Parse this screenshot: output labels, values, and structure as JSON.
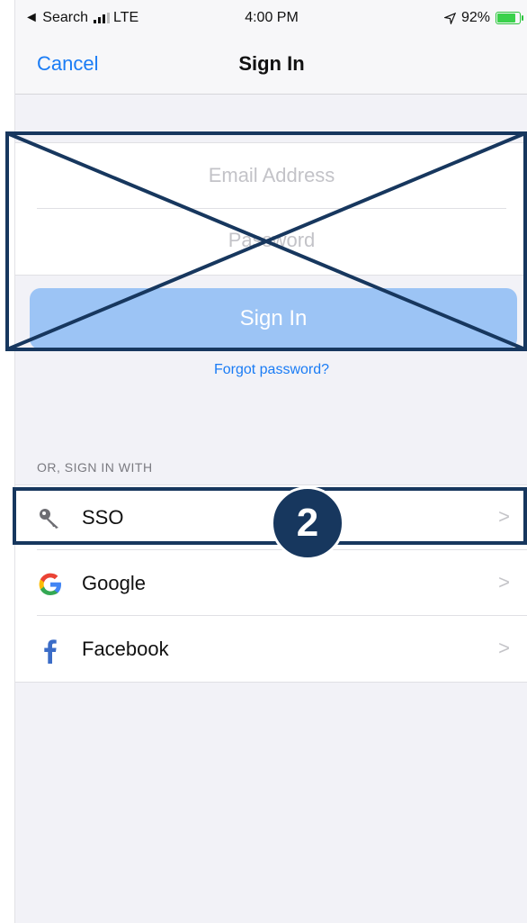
{
  "status_bar": {
    "back_app": "◄ Search",
    "carrier": "LTE",
    "time": "4:00 PM",
    "battery": "92%",
    "battery_level": 0.92
  },
  "navbar": {
    "cancel_label": "Cancel",
    "title": "Sign In"
  },
  "form": {
    "email_placeholder": "Email Address",
    "password_placeholder": "Password",
    "signin_label": "Sign In",
    "forgot_label": "Forgot password?"
  },
  "alt_signin": {
    "section_label": "OR, SIGN IN WITH",
    "items": [
      {
        "label": "SSO",
        "icon": "key-icon",
        "chevron": ">"
      },
      {
        "label": "Google",
        "icon": "google-icon",
        "chevron": ">"
      },
      {
        "label": "Facebook",
        "icon": "facebook-icon",
        "chevron": ">"
      }
    ]
  },
  "annotation": {
    "step_number": "2",
    "color": "#17375e"
  },
  "colors": {
    "accent": "#1a7cf5",
    "button_disabled": "#9cc4f5",
    "background": "#f2f2f7"
  }
}
